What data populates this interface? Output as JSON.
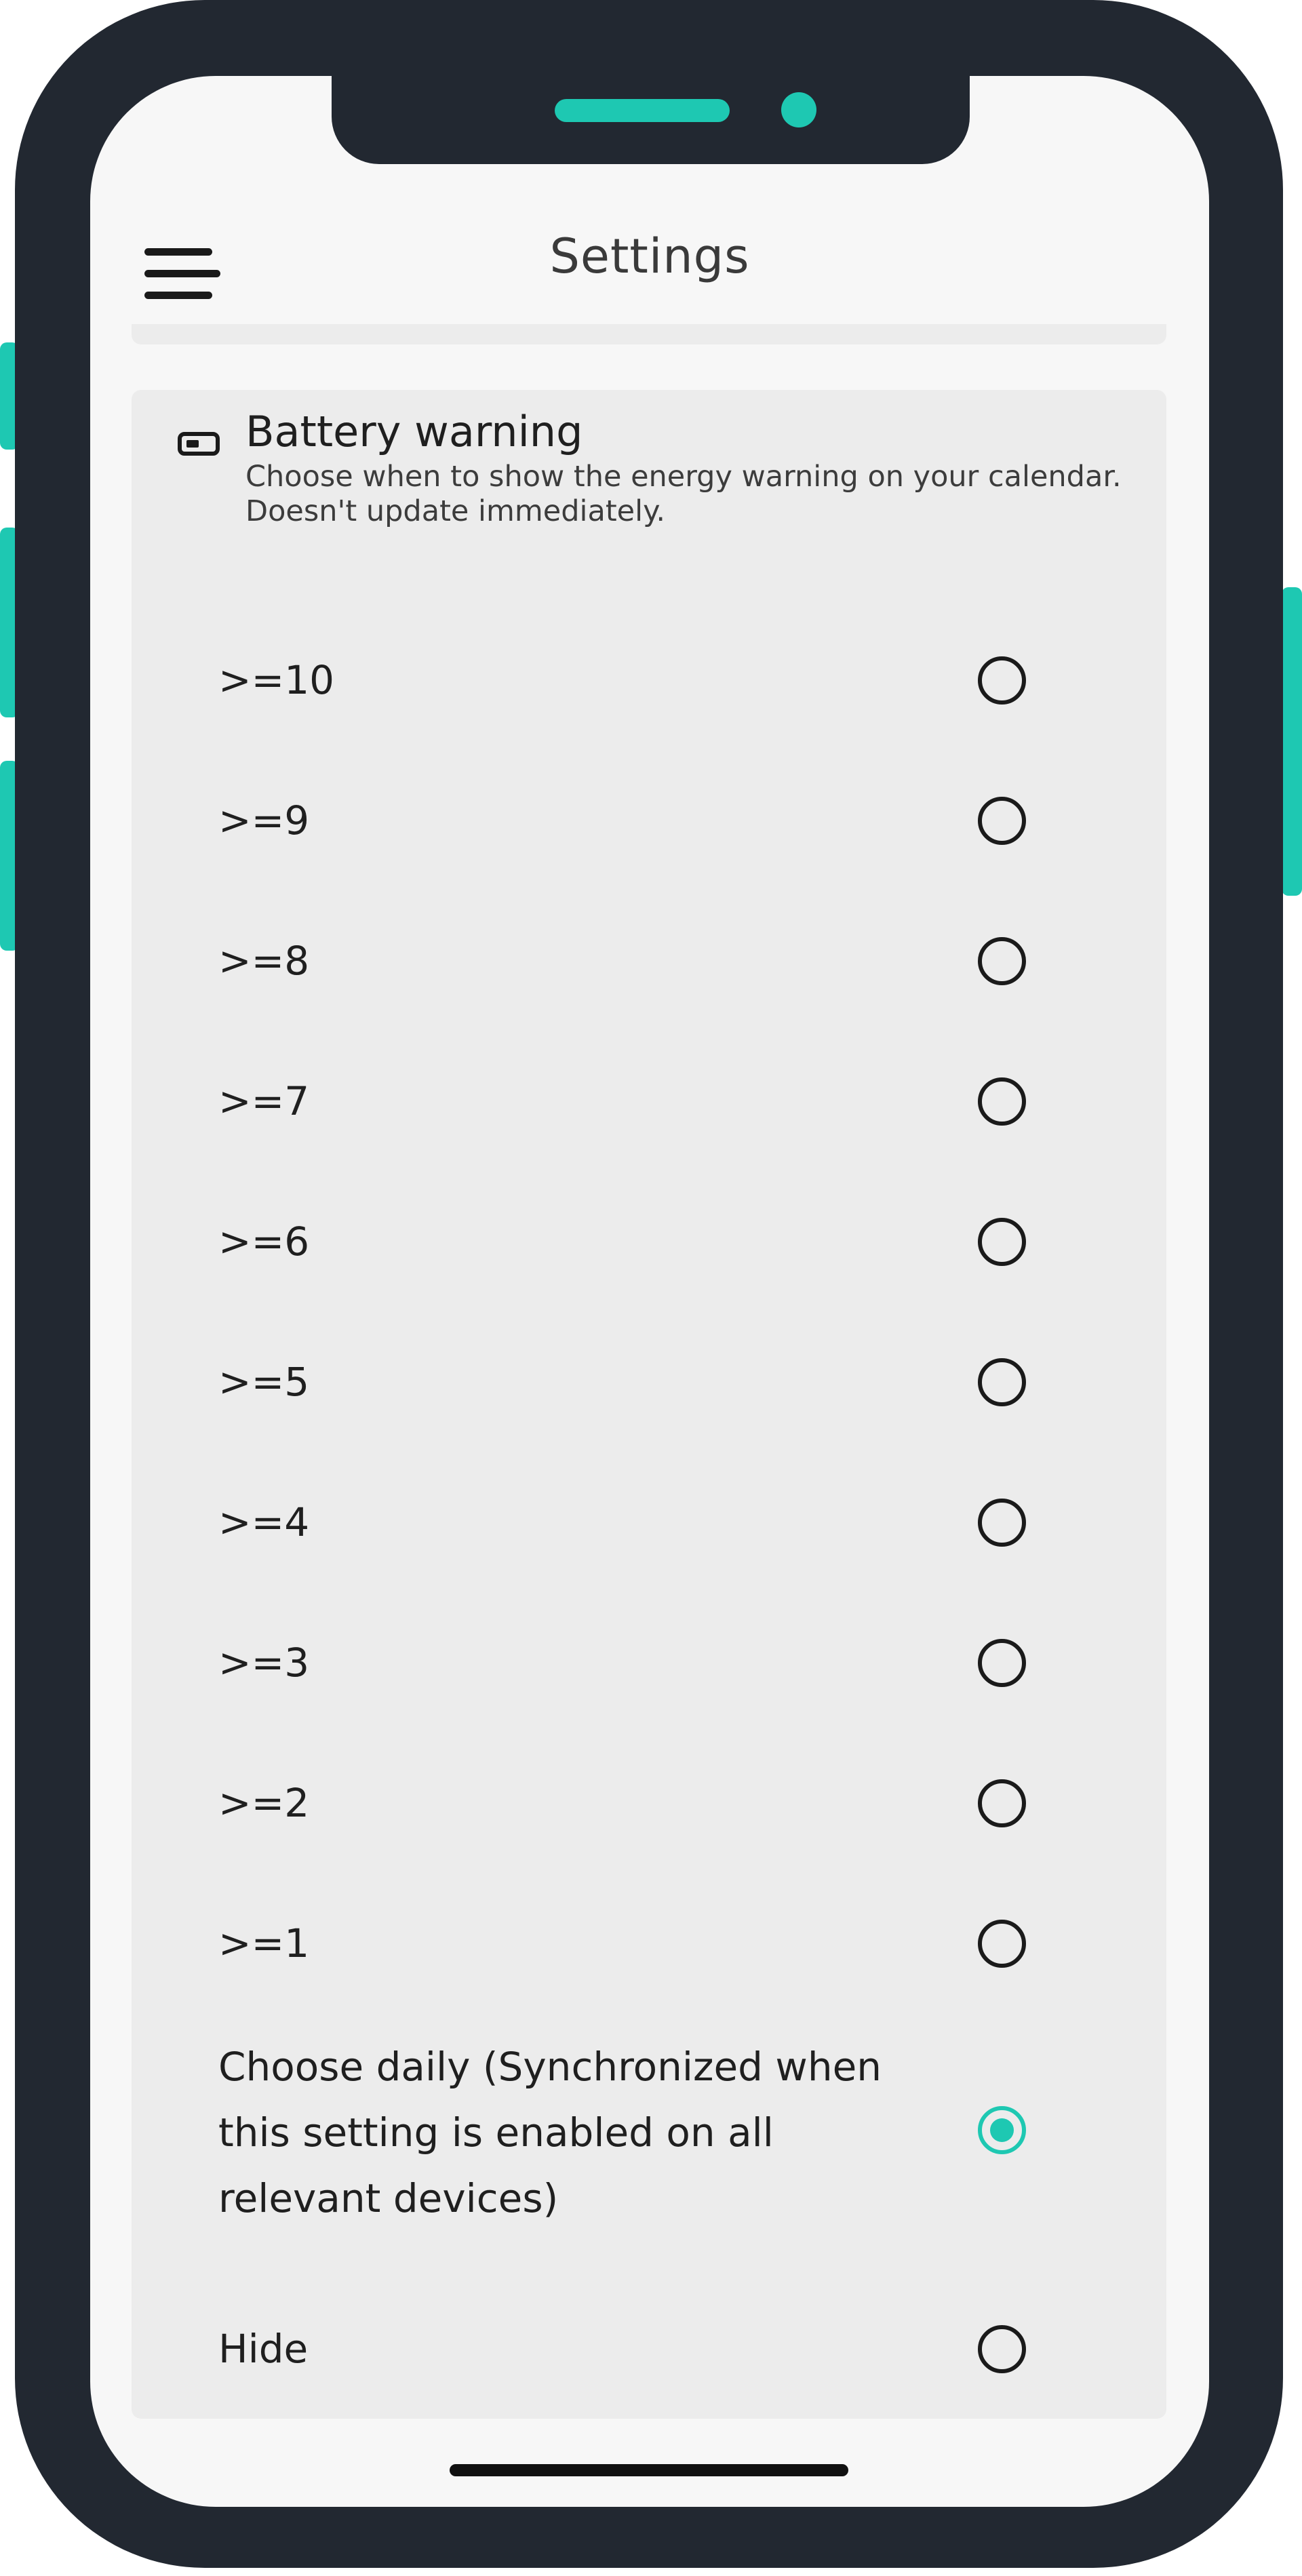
{
  "header": {
    "title": "Settings",
    "menu_icon": "hamburger-menu-icon"
  },
  "battery_warning": {
    "icon": "battery-low-icon",
    "title": "Battery warning",
    "description": "Choose when to show the energy warning on your calendar. Doesn't update immediately.",
    "options": [
      {
        "label": ">=10",
        "selected": false
      },
      {
        "label": ">=9",
        "selected": false
      },
      {
        "label": ">=8",
        "selected": false
      },
      {
        "label": ">=7",
        "selected": false
      },
      {
        "label": ">=6",
        "selected": false
      },
      {
        "label": ">=5",
        "selected": false
      },
      {
        "label": ">=4",
        "selected": false
      },
      {
        "label": ">=3",
        "selected": false
      },
      {
        "label": ">=2",
        "selected": false
      },
      {
        "label": ">=1",
        "selected": false
      },
      {
        "label": "Choose daily (Synchronized when this setting is enabled on all relevant devices)",
        "selected": true
      },
      {
        "label": "Hide",
        "selected": false
      }
    ]
  },
  "colors": {
    "accent": "#1ec8b2",
    "frame": "#222831",
    "card_background": "#ececec",
    "screen_background": "#f7f7f7"
  }
}
